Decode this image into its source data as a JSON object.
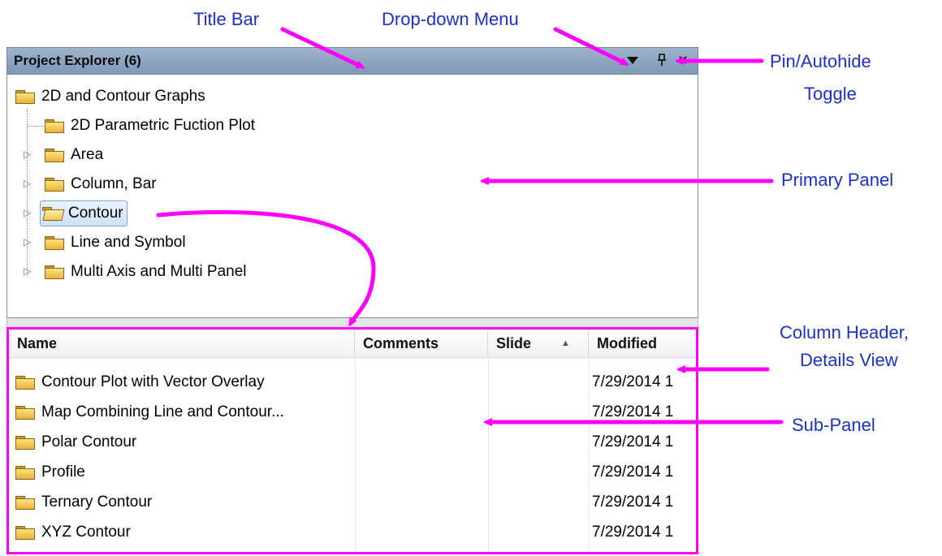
{
  "callouts": {
    "title_bar": "Title Bar",
    "dropdown_menu": "Drop-down Menu",
    "pin_line1": "Pin/Autohide",
    "pin_line2": "Toggle",
    "primary_panel": "Primary Panel",
    "column_header_line1": "Column Header,",
    "column_header_line2": "Details View",
    "sub_panel": "Sub-Panel"
  },
  "window": {
    "title": "Project Explorer (6)"
  },
  "tree": {
    "root": "2D and Contour Graphs",
    "children": [
      {
        "label": "2D Parametric Fuction Plot",
        "expandable": false
      },
      {
        "label": "Area",
        "expandable": true
      },
      {
        "label": "Column, Bar",
        "expandable": true
      },
      {
        "label": "Contour",
        "expandable": true,
        "selected": true
      },
      {
        "label": "Line and Symbol",
        "expandable": true
      },
      {
        "label": "Multi Axis and Multi Panel",
        "expandable": true
      }
    ]
  },
  "details": {
    "columns": [
      "Name",
      "Comments",
      "Slide",
      "Modified"
    ],
    "sort_indicator": "▲",
    "rows": [
      {
        "name": "Contour Plot with Vector Overlay",
        "modified": "7/29/2014 1"
      },
      {
        "name": "Map Combining Line and Contour...",
        "modified": "7/29/2014 1"
      },
      {
        "name": "Polar Contour",
        "modified": "7/29/2014 1"
      },
      {
        "name": "Profile",
        "modified": "7/29/2014 1"
      },
      {
        "name": "Ternary Contour",
        "modified": "7/29/2014 1"
      },
      {
        "name": "XYZ Contour",
        "modified": "7/29/2014 1"
      }
    ]
  },
  "colors": {
    "callout_text": "#1a32c8",
    "arrow": "#ff00ff",
    "titlebar": "#8ea5c1"
  }
}
